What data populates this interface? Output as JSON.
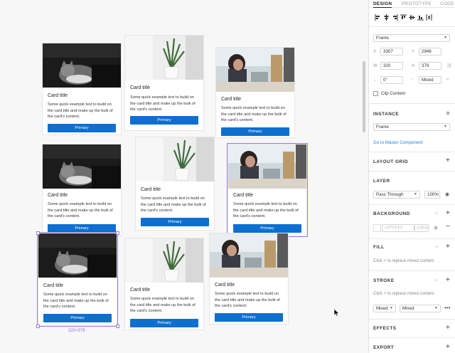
{
  "canvas": {
    "cards": [
      {
        "title": "Card title",
        "text": "Some quick example text to build on the card title and make up the bulk of the card's content.",
        "button": "Primary",
        "image": "cat"
      },
      {
        "title": "Card title",
        "text": "Some quick example text to build on the card title and make up the bulk of the card's content.",
        "button": "Primary",
        "image": "plant"
      },
      {
        "title": "Card title",
        "text": "Some quick example text to build on the card title and make up the bulk of the card's content.",
        "button": "Primary",
        "image": "woman"
      },
      {
        "title": "Card title",
        "text": "Some quick example text to build on the card title and make up the bulk of the card's content.",
        "button": "Primary",
        "image": "cat"
      },
      {
        "title": "Card title",
        "text": "Some quick example text to build on the card title and make up the bulk of the card's content.",
        "button": "Primary",
        "image": "plant"
      },
      {
        "title": "Card title",
        "text": "Some quick example text to build on the card title and make up the bulk of the card's content.",
        "button": "Primary",
        "image": "woman"
      },
      {
        "title": "Card title",
        "text": "Some quick example text to build on the card title and make up the bulk of the card's content.",
        "button": "Primary",
        "image": "cat"
      },
      {
        "title": "Card title",
        "text": "Some quick example text to build on the card title and make up the bulk of the card's content.",
        "button": "Primary",
        "image": "plant"
      },
      {
        "title": "Card title",
        "text": "Some quick example text to build on the card title and make up the bulk of the card's content.",
        "button": "Primary",
        "image": "woman"
      }
    ],
    "selection_size": "320×379"
  },
  "panel": {
    "tabs": [
      "DESIGN",
      "PROTOTYPE",
      "CODE"
    ],
    "frame_select": "Frame",
    "x_label": "X",
    "x_value": "3307",
    "y_label": "Y",
    "y_value": "2946",
    "w_label": "W",
    "w_value": "320",
    "h_label": "H",
    "h_value": "379",
    "rotation_value": "0°",
    "radius_value": "Mixed",
    "clip_content": "Clip Content",
    "instance": {
      "title": "INSTANCE",
      "select": "Frame",
      "link": "Go to Master Component"
    },
    "layout_grid": {
      "title": "LAYOUT GRID"
    },
    "layer": {
      "title": "LAYER",
      "blend": "Pass Through",
      "opacity": "100%"
    },
    "background": {
      "title": "BACKGROUND",
      "hex": "#FFFFFF",
      "opacity": "100%"
    },
    "fill": {
      "title": "FILL",
      "hint": "Click + to replace mixed content."
    },
    "stroke": {
      "title": "STROKE",
      "hint": "Click + to replace mixed content.",
      "weight": "Mixed",
      "position": "Mixed"
    },
    "effects": {
      "title": "EFFECTS"
    },
    "export": {
      "title": "EXPORT"
    }
  },
  "colors": {
    "accent": "#0d6fd0",
    "selection": "#9a7be0",
    "link": "#1e88e5"
  }
}
